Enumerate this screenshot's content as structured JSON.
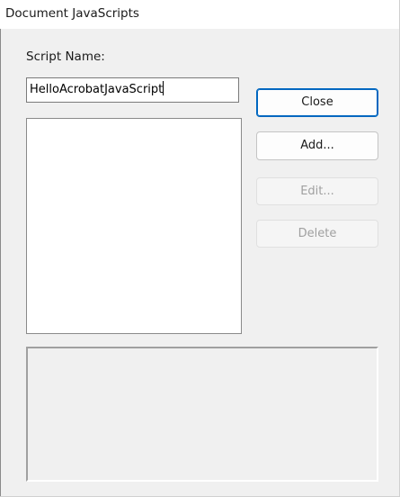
{
  "window": {
    "title": "Document JavaScripts"
  },
  "form": {
    "script_name_label": "Script Name:",
    "script_name_value": "HelloAcrobatJavaScript",
    "scripts": []
  },
  "buttons": {
    "close": "Close",
    "add": "Add...",
    "edit": "Edit...",
    "delete": "Delete"
  },
  "colors": {
    "dialog_background": "#f0f0f0",
    "title_bar_background": "#ffffff",
    "default_button_border": "#0067c0",
    "disabled_text": "#a0a0a0"
  }
}
